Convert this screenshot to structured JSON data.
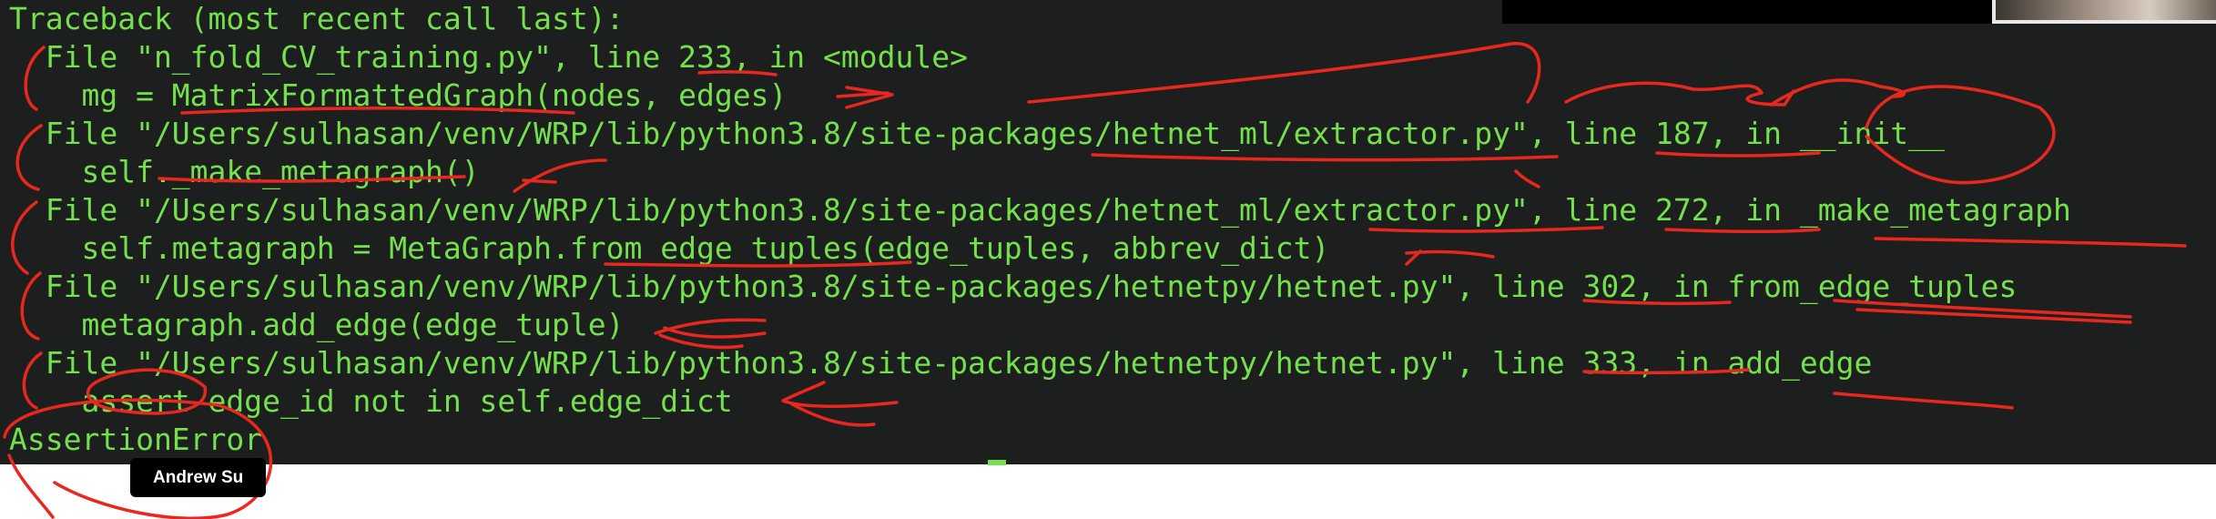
{
  "terminal": {
    "lines": [
      "Traceback (most recent call last):",
      "  File \"n_fold_CV_training.py\", line 233, in <module>",
      "    mg = MatrixFormattedGraph(nodes, edges)",
      "  File \"/Users/sulhasan/venv/WRP/lib/python3.8/site-packages/hetnet_ml/extractor.py\", line 187, in __init__",
      "    self._make_metagraph()",
      "  File \"/Users/sulhasan/venv/WRP/lib/python3.8/site-packages/hetnet_ml/extractor.py\", line 272, in _make_metagraph",
      "    self.metagraph = MetaGraph.from_edge_tuples(edge_tuples, abbrev_dict)",
      "  File \"/Users/sulhasan/venv/WRP/lib/python3.8/site-packages/hetnetpy/hetnet.py\", line 302, in from_edge_tuples",
      "    metagraph.add_edge(edge_tuple)",
      "  File \"/Users/sulhasan/venv/WRP/lib/python3.8/site-packages/hetnetpy/hetnet.py\", line 333, in add_edge",
      "    assert edge_id not in self.edge_dict",
      "AssertionError"
    ]
  },
  "participant_name": "Andrew Su",
  "colors": {
    "terminal_bg": "#1c1f1d",
    "terminal_text": "#74e04d",
    "annotation": "#e8271f"
  }
}
